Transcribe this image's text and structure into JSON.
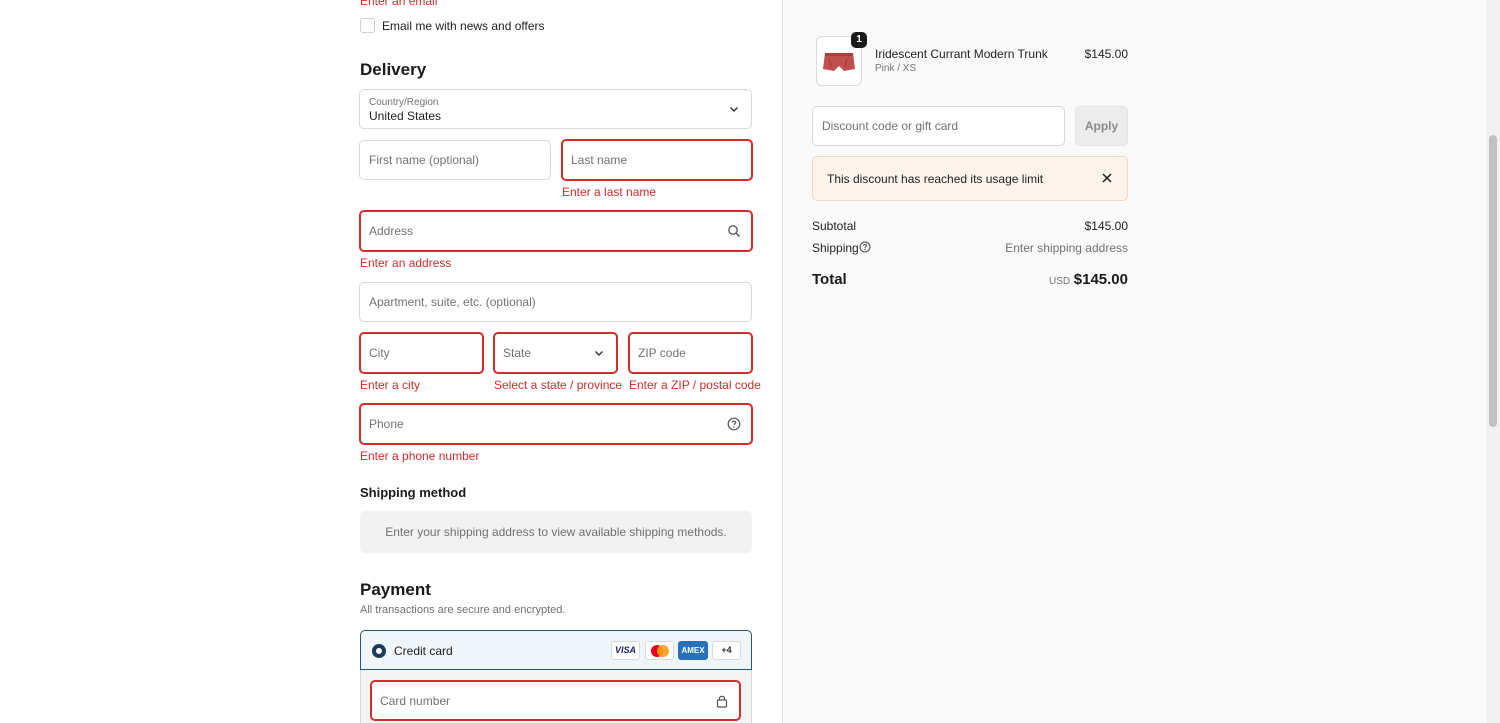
{
  "contact": {
    "email_error_partial": "Enter an email",
    "newsletter_label": "Email me with news and offers"
  },
  "delivery": {
    "heading": "Delivery",
    "country_label": "Country/Region",
    "country_value": "United States",
    "first_name_placeholder": "First name (optional)",
    "last_name_placeholder": "Last name",
    "last_name_error": "Enter a last name",
    "address_placeholder": "Address",
    "address_error": "Enter an address",
    "apartment_placeholder": "Apartment, suite, etc. (optional)",
    "city_placeholder": "City",
    "city_error": "Enter a city",
    "state_placeholder": "State",
    "state_error": "Select a state / province",
    "zip_placeholder": "ZIP code",
    "zip_error": "Enter a ZIP / postal code",
    "phone_placeholder": "Phone",
    "phone_error": "Enter a phone number"
  },
  "shipping_method": {
    "heading": "Shipping method",
    "message": "Enter your shipping address to view available shipping methods."
  },
  "payment": {
    "heading": "Payment",
    "subheading": "All transactions are secure and encrypted.",
    "credit_card_label": "Credit card",
    "card_logos": [
      "VISA",
      "Mastercard",
      "AMEX",
      "+4"
    ],
    "card_number_placeholder": "Card number"
  },
  "summary": {
    "item": {
      "quantity": "1",
      "name": "Iridescent Currant Modern Trunk",
      "variant": "Pink / XS",
      "price": "$145.00"
    },
    "discount_placeholder": "Discount code or gift card",
    "apply_label": "Apply",
    "notice": "This discount has reached its usage limit",
    "subtotal_label": "Subtotal",
    "subtotal_value": "$145.00",
    "shipping_label": "Shipping",
    "shipping_value": "Enter shipping address",
    "total_label": "Total",
    "currency": "USD",
    "total_value": "$145.00"
  },
  "colors": {
    "error": "#d22d2d",
    "accent": "#1d5a8a",
    "notice_bg": "#fff4ec"
  }
}
